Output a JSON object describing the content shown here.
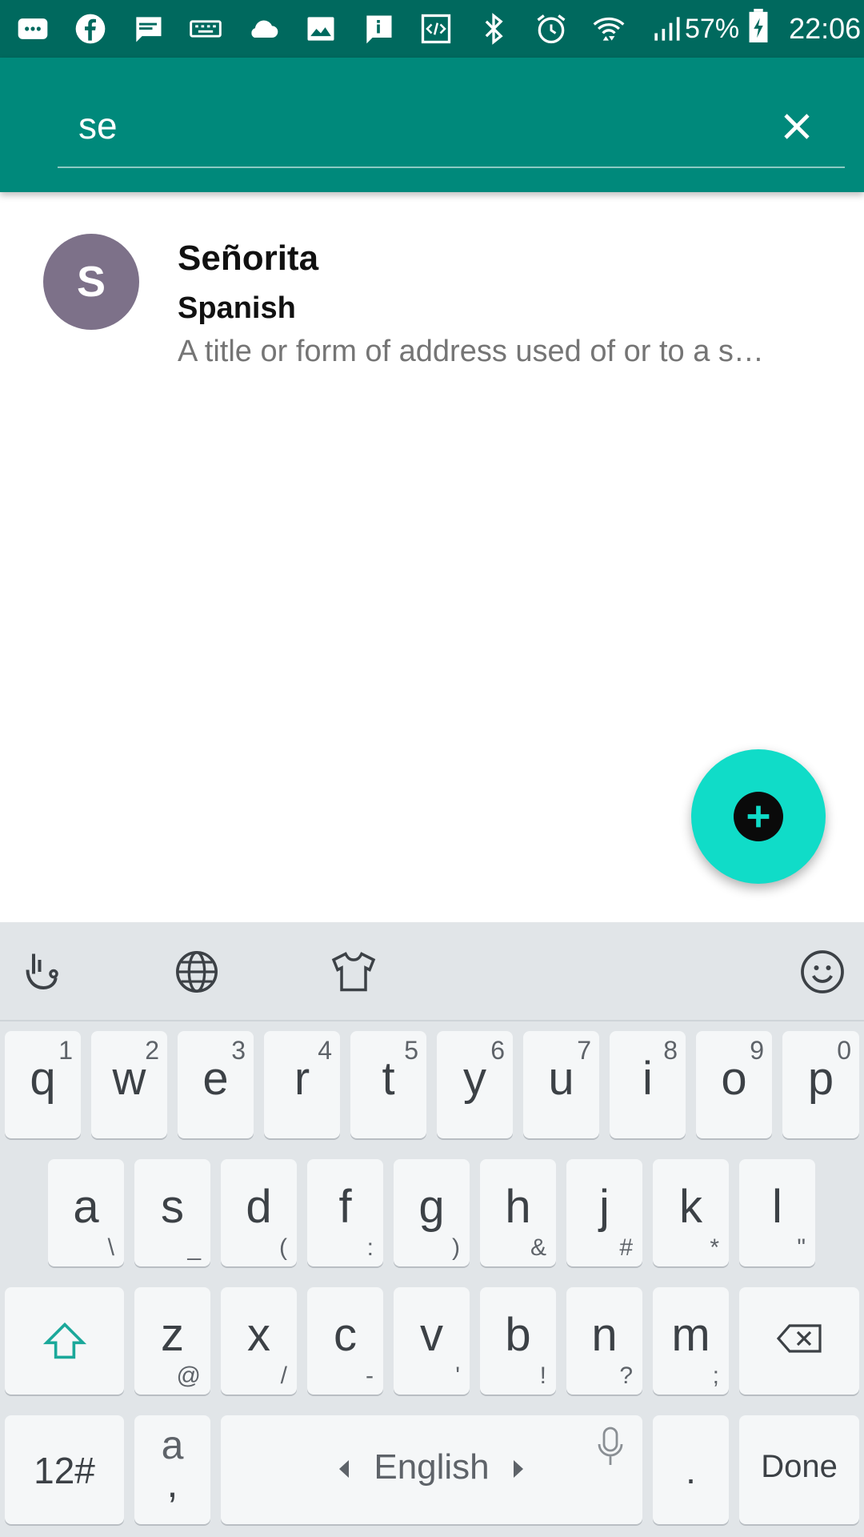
{
  "status_bar": {
    "icons": [
      "message-icon",
      "facebook-icon",
      "chat-icon",
      "keyboard-icon",
      "cloud-icon",
      "image-icon",
      "info-icon",
      "code-icon",
      "bluetooth-icon",
      "alarm-icon",
      "wifi-icon",
      "signal-icon"
    ],
    "battery": "57%",
    "time": "22:06",
    "color": "#00695e"
  },
  "search": {
    "value": "se",
    "accent": "#00897b"
  },
  "results": [
    {
      "avatar_letter": "S",
      "word": "Señorita",
      "language": "Spanish",
      "definition": "A title or form of address used of or to a s…",
      "avatar_color": "#7d7189"
    }
  ],
  "fab": {
    "icon": "add-icon",
    "color": "#10dcc8"
  },
  "keyboard": {
    "toolbar": [
      "gesture-icon",
      "globe-icon",
      "shirt-icon",
      "emoji-icon"
    ],
    "row1": [
      {
        "k": "q",
        "s": "1"
      },
      {
        "k": "w",
        "s": "2"
      },
      {
        "k": "e",
        "s": "3"
      },
      {
        "k": "r",
        "s": "4"
      },
      {
        "k": "t",
        "s": "5"
      },
      {
        "k": "y",
        "s": "6"
      },
      {
        "k": "u",
        "s": "7"
      },
      {
        "k": "i",
        "s": "8"
      },
      {
        "k": "o",
        "s": "9"
      },
      {
        "k": "p",
        "s": "0"
      }
    ],
    "row2": [
      {
        "k": "a",
        "s": "\\"
      },
      {
        "k": "s",
        "s": "_"
      },
      {
        "k": "d",
        "s": "("
      },
      {
        "k": "f",
        "s": ":"
      },
      {
        "k": "g",
        "s": ")"
      },
      {
        "k": "h",
        "s": "&"
      },
      {
        "k": "j",
        "s": "#"
      },
      {
        "k": "k",
        "s": "*"
      },
      {
        "k": "l",
        "s": "\""
      }
    ],
    "row3": [
      {
        "k": "z",
        "s": "@"
      },
      {
        "k": "x",
        "s": "/"
      },
      {
        "k": "c",
        "s": "-"
      },
      {
        "k": "v",
        "s": "'"
      },
      {
        "k": "b",
        "s": "!"
      },
      {
        "k": "n",
        "s": "?"
      },
      {
        "k": "m",
        "s": ";"
      }
    ],
    "symbols_label": "12#",
    "alt_key_top": "a",
    "alt_key_bottom": ",",
    "space_label": "English",
    "period_label": ".",
    "done_label": "Done"
  }
}
